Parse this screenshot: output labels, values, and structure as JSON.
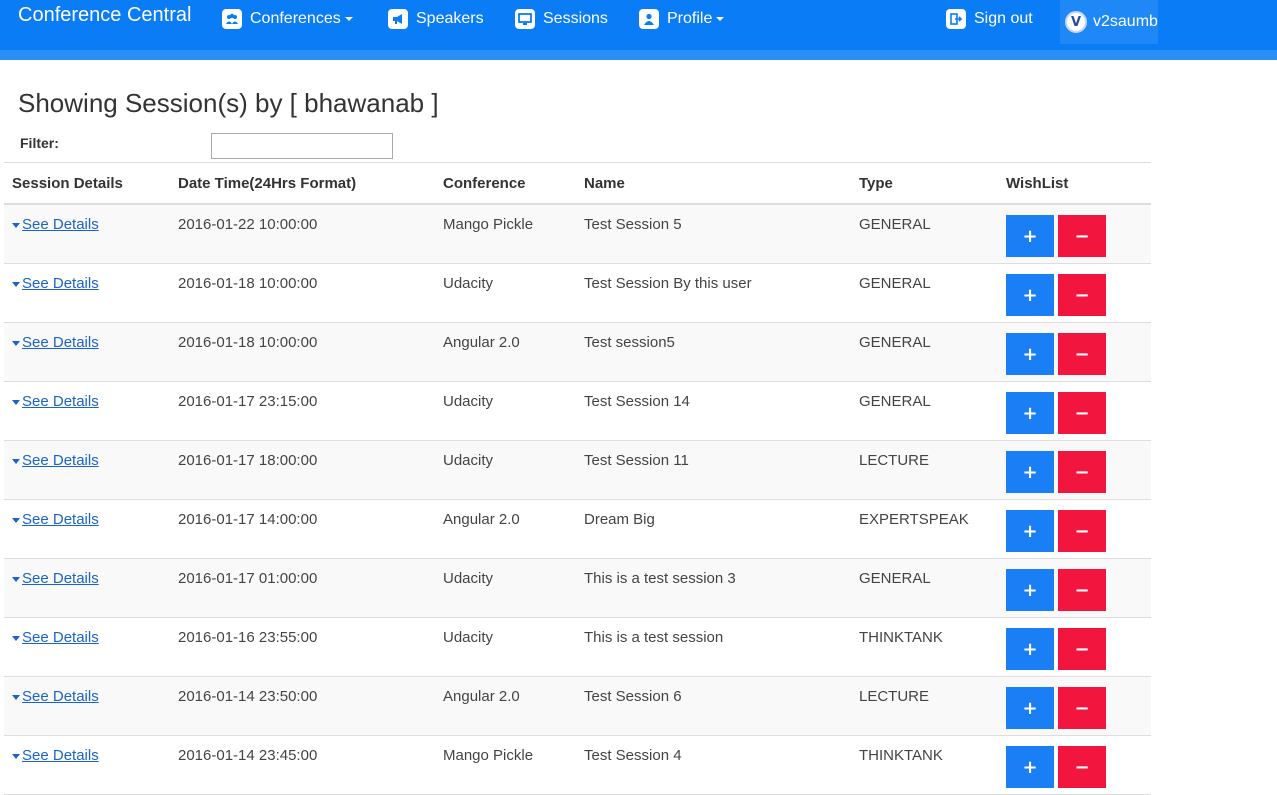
{
  "nav": {
    "brand": "Conference Central",
    "items": [
      {
        "label": "Conferences",
        "icon": "group-icon",
        "dropdown": true
      },
      {
        "label": "Speakers",
        "icon": "megaphone-icon",
        "dropdown": false
      },
      {
        "label": "Sessions",
        "icon": "monitor-icon",
        "dropdown": false
      },
      {
        "label": "Profile",
        "icon": "user-icon",
        "dropdown": true
      }
    ],
    "signout": "Sign out",
    "avatar_letter": "V",
    "username": "v2saumb",
    "colors": {
      "navbar": "#0a7cf5",
      "accent": "#2a8ef7"
    }
  },
  "page": {
    "title": "Showing Session(s) by [ bhawanab ]",
    "filter_label": "Filter:",
    "filter_value": ""
  },
  "table": {
    "columns": [
      "Session Details",
      "Date Time(24Hrs Format)",
      "Conference",
      "Name",
      "Type",
      "WishList"
    ],
    "details_label": "See Details",
    "add_symbol": "+",
    "remove_symbol": "−",
    "colors": {
      "add": "#1a7ef4",
      "remove": "#f2163f"
    },
    "rows": [
      {
        "datetime": "2016-01-22 10:00:00",
        "conference": "Mango Pickle",
        "name": "Test Session 5",
        "type": "GENERAL"
      },
      {
        "datetime": "2016-01-18 10:00:00",
        "conference": "Udacity",
        "name": "Test Session By this user",
        "type": "GENERAL"
      },
      {
        "datetime": "2016-01-18 10:00:00",
        "conference": "Angular 2.0",
        "name": "Test session5",
        "type": "GENERAL"
      },
      {
        "datetime": "2016-01-17 23:15:00",
        "conference": "Udacity",
        "name": "Test Session 14",
        "type": "GENERAL"
      },
      {
        "datetime": "2016-01-17 18:00:00",
        "conference": "Udacity",
        "name": "Test Session 11",
        "type": "LECTURE"
      },
      {
        "datetime": "2016-01-17 14:00:00",
        "conference": "Angular 2.0",
        "name": "Dream Big",
        "type": "EXPERTSPEAK"
      },
      {
        "datetime": "2016-01-17 01:00:00",
        "conference": "Udacity",
        "name": "This is a test session 3",
        "type": "GENERAL"
      },
      {
        "datetime": "2016-01-16 23:55:00",
        "conference": "Udacity",
        "name": "This is a test session",
        "type": "THINKTANK"
      },
      {
        "datetime": "2016-01-14 23:50:00",
        "conference": "Angular 2.0",
        "name": "Test Session 6",
        "type": "LECTURE"
      },
      {
        "datetime": "2016-01-14 23:45:00",
        "conference": "Mango Pickle",
        "name": "Test Session 4",
        "type": "THINKTANK"
      }
    ]
  }
}
